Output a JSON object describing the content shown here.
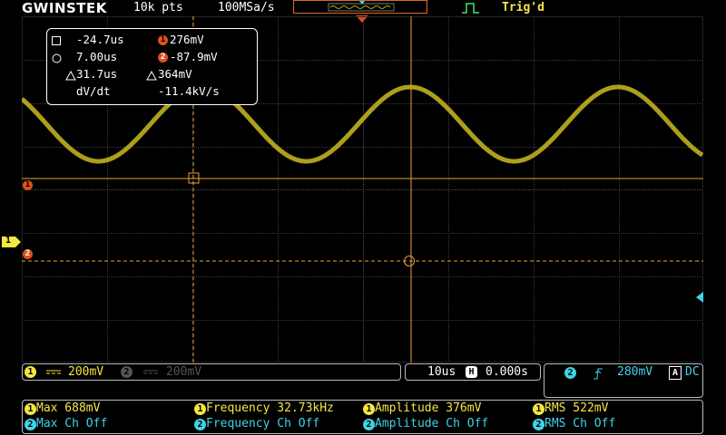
{
  "top": {
    "brand": "GWINSTEK",
    "record_length": "10k pts",
    "sample_rate": "100MSa/s",
    "trigger_status": "Trig'd"
  },
  "cursor_readout": {
    "h1_time": "-24.7us",
    "h2_time": "7.00us",
    "delta_time": "31.7us",
    "ch1_label": "1",
    "ch2_label": "2",
    "v1": "276mV",
    "v2": "-87.9mV",
    "delta_v": "364mV",
    "dvdt_label": "dV/dt",
    "dvdt_value": "-11.4kV/s"
  },
  "markers": {
    "ch1": "1",
    "cursor1": "1",
    "cursor2": "2"
  },
  "channel_bar": {
    "ch1_num": "1",
    "ch1_scale": "200mV",
    "ch2_num": "2",
    "ch2_scale": "200mV"
  },
  "timebase": {
    "scale": "10us",
    "delay_icon": "H",
    "position": "0.000s"
  },
  "trigger_panel": {
    "source": "2",
    "level": "280mV",
    "coupling_badge": "A",
    "coupling": "DC"
  },
  "measurements": [
    {
      "ch": "1",
      "text": "Max 688mV"
    },
    {
      "ch": "1",
      "text": "Frequency 32.73kHz"
    },
    {
      "ch": "1",
      "text": "Amplitude 376mV"
    },
    {
      "ch": "1",
      "text": "RMS 522mV"
    },
    {
      "ch": "2",
      "text": "Max Ch Off"
    },
    {
      "ch": "2",
      "text": "Frequency Ch Off"
    },
    {
      "ch": "2",
      "text": "Amplitude Ch Off"
    },
    {
      "ch": "2",
      "text": "RMS Ch Off"
    }
  ],
  "colors": {
    "ch1": "#f5e642",
    "ch2": "#3fd3e6",
    "trace": "#b5a81c",
    "cursor": "#e8a23a"
  }
}
